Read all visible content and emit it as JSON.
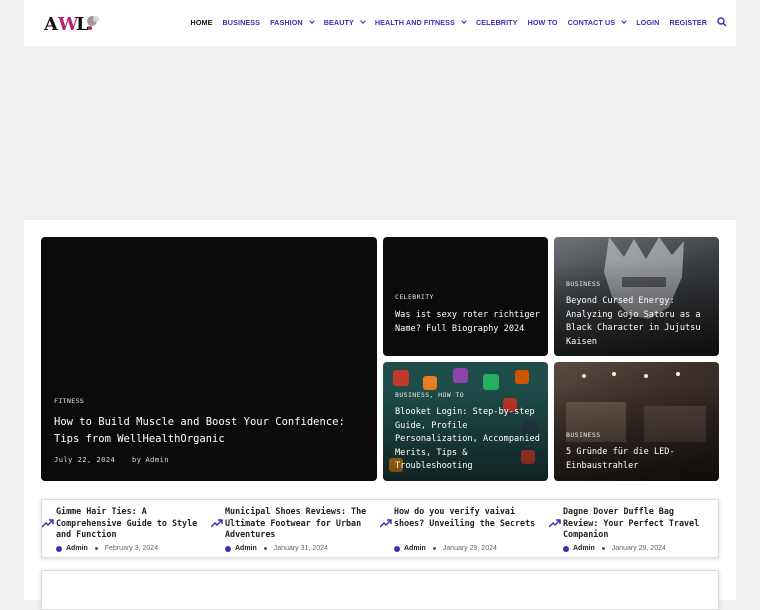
{
  "logo": {
    "text": "AWL",
    "colors": [
      "#111111",
      "#b5256f",
      "#9a9a9a"
    ]
  },
  "nav": {
    "items": [
      {
        "label": "Home",
        "active": true,
        "dropdown": false
      },
      {
        "label": "Business",
        "active": false,
        "dropdown": false
      },
      {
        "label": "Fashion",
        "active": false,
        "dropdown": true
      },
      {
        "label": "Beauty",
        "active": false,
        "dropdown": true
      },
      {
        "label": "Health and Fitness",
        "active": false,
        "dropdown": true
      },
      {
        "label": "Celebrity",
        "active": false,
        "dropdown": false
      },
      {
        "label": "How To",
        "active": false,
        "dropdown": false
      },
      {
        "label": "Contact Us",
        "active": false,
        "dropdown": true
      },
      {
        "label": "Login",
        "active": false,
        "dropdown": false
      },
      {
        "label": "Register",
        "active": false,
        "dropdown": false
      }
    ],
    "search_icon": "search-icon",
    "accent": "#3b2db8"
  },
  "featured": {
    "category": "FITNESS",
    "title": "How to Build Muscle and Boost Your Confidence: Tips from WellHealthOrganic",
    "date": "July 22, 2024",
    "by": "by",
    "author": "Admin"
  },
  "cards": [
    {
      "category": "CELEBRITY",
      "title": "Was ist sexy roter richtiger Name? Full Biography 2024"
    },
    {
      "category": "BUSINESS",
      "title": "Beyond Cursed Energy: Analyzing Gojo Satoru as a Black Character in Jujutsu Kaisen"
    },
    {
      "category": "BUSINESS, HOW TO",
      "title": "Blooket Login: Step-by-step Guide, Profile Personalization, Accompanied Merits, Tips & Troubleshooting"
    },
    {
      "category": "BUSINESS",
      "title": "5 Gründe für die LED-Einbaustrahler"
    }
  ],
  "trending": [
    {
      "title": "Gimme Hair Ties: A Comprehensive Guide to Style and Function",
      "author": "Admin",
      "date": "February 3, 2024"
    },
    {
      "title": "Municipal Shoes Reviews: The Ultimate Footwear for Urban Adventures",
      "author": "Admin",
      "date": "January 31, 2024"
    },
    {
      "title": "How do you verify vaivai shoes? Unveiling the Secrets",
      "author": "Admin",
      "date": "January 29, 2024"
    },
    {
      "title": "Dagne Dover Duffle Bag Review: Your Perfect Travel Companion",
      "author": "Admin",
      "date": "January 29, 2024"
    }
  ]
}
